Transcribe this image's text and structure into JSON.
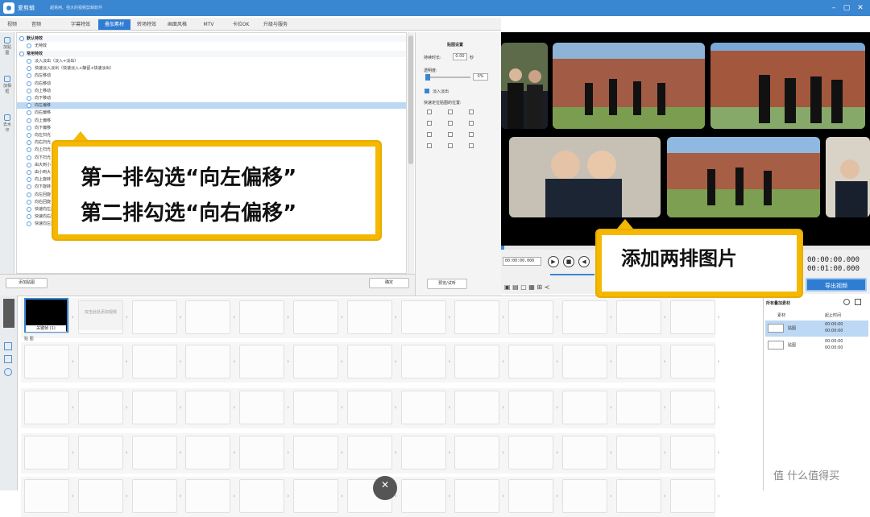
{
  "titlebar": {
    "app_name": "爱剪辑",
    "slogan": "超易用、强大的视频剪辑软件",
    "minimize": "–",
    "restore": "▢",
    "close": "✕"
  },
  "tabs": [
    {
      "label": "视频"
    },
    {
      "label": "音频"
    },
    {
      "label": "字幕特效"
    },
    {
      "label": "叠加素材"
    },
    {
      "label": "转场特效"
    },
    {
      "label": "画面风格"
    },
    {
      "label": "MTV"
    },
    {
      "label": "卡拉OK"
    },
    {
      "label": "升级与服务"
    }
  ],
  "sidenav": [
    {
      "label": "加贴图"
    },
    {
      "label": "加相框"
    },
    {
      "label": "去水印"
    }
  ],
  "effects": {
    "group1": "默认特效",
    "group1_item": "无特效",
    "group2": "常用特效",
    "items": [
      "淡入淡出（淡入+淡出）",
      "快速淡入淡出（快速淡入+静留+快速淡出）",
      "向左移动",
      "向右移动",
      "向上移动",
      "向下移动",
      "向左偏移",
      "向右偏移",
      "向上偏移",
      "向下偏移",
      "向左扫光",
      "向右扫光",
      "向上扫光",
      "向下扫光",
      "由大到小",
      "由小到大",
      "向上旋转",
      "向下旋转",
      "向左回旋",
      "向右回旋",
      "快速向左渐入",
      "快速向右渐入",
      "快速向左渐出"
    ],
    "selected_index": 6
  },
  "settings": {
    "header": "贴图设置",
    "duration_label": "持续时长:",
    "duration_value": "0.00",
    "duration_unit": "秒",
    "opacity_label": "透明度:",
    "opacity_value": "0%",
    "fade_label": "淡入淡出",
    "position_label": "快速定位贴图的位置:",
    "preview_button": "预览/试听"
  },
  "bottom_bar": {
    "add_button": "添加贴图",
    "confirm_button": "确定"
  },
  "player": {
    "time_input": "00:00:00.000",
    "elapsed": "00:00:00.000",
    "total": "00:01:00.000",
    "export_button": "导出视频"
  },
  "timeline": {
    "first_clip_label": "关键帧 (1)",
    "placeholder_clip": "双击此处添加视频",
    "track_label": "贴 图"
  },
  "right_panel": {
    "header": "所有叠加素材",
    "col_material": "素材",
    "col_time": "起止时间",
    "rows": [
      {
        "name": "贴图",
        "start": "00:00:00",
        "end": "00:00:00"
      },
      {
        "name": "贴图",
        "start": "00:00:00",
        "end": "00:00:00"
      }
    ]
  },
  "callouts": {
    "line1": "第一排勾选“向左偏移”",
    "line2": "第二排勾选“向右偏移”",
    "right": "添加两排图片"
  },
  "watermark": "值 什么值得买"
}
